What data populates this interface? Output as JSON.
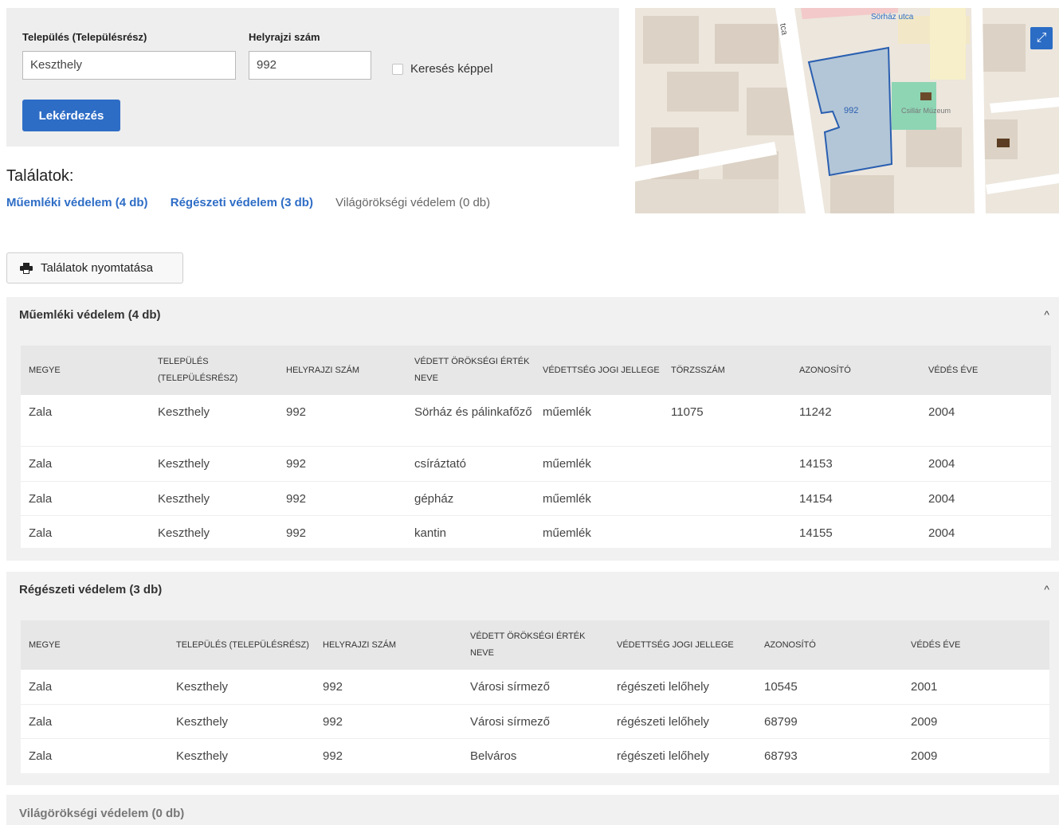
{
  "search": {
    "settlement_label": "Település (Településrész)",
    "settlement_value": "Keszthely",
    "parcel_label": "Helyrajzi szám",
    "parcel_value": "992",
    "image_search_label": "Keresés képpel",
    "query_button": "Lekérdezés"
  },
  "map": {
    "parcel_label": "992",
    "poi_labels": [
      "Sörház utca",
      "Csillár Múzeum"
    ],
    "street_label": "tca",
    "expand_icon": "expand-icon"
  },
  "results": {
    "title": "Találatok:",
    "links": [
      {
        "label": "Műemléki védelem (4 db)"
      },
      {
        "label": "Régészeti védelem (3 db)"
      },
      {
        "label": "Világörökségi védelem (0 db)"
      }
    ],
    "print_button": "Találatok nyomtatása"
  },
  "monuments": {
    "title": "Műemléki védelem (4 db)",
    "headers": [
      "Megye",
      "Település (településrész)",
      "Helyrajzi szám",
      "Védett örökségi érték neve",
      "Védettség jogi jellege",
      "Törzsszám",
      "Azonosító",
      "Védés éve"
    ],
    "rows": [
      [
        "Zala",
        "Keszthely",
        "992",
        "Sörház és pálinkafőző",
        "műemlék",
        "11075",
        "11242",
        "2004"
      ],
      [
        "Zala",
        "Keszthely",
        "992",
        "csíráztató",
        "műemlék",
        "",
        "14153",
        "2004"
      ],
      [
        "Zala",
        "Keszthely",
        "992",
        "gépház",
        "műemlék",
        "",
        "14154",
        "2004"
      ],
      [
        "Zala",
        "Keszthely",
        "992",
        "kantin",
        "műemlék",
        "",
        "14155",
        "2004"
      ]
    ]
  },
  "archaeology": {
    "title": "Régészeti védelem (3 db)",
    "headers": [
      "Megye",
      "Település (településrész)",
      "Helyrajzi szám",
      "Védett örökségi érték neve",
      "Védettség jogi jellege",
      "Azonosító",
      "Védés éve"
    ],
    "rows": [
      [
        "Zala",
        "Keszthely",
        "992",
        "Városi sírmező",
        "régészeti lelőhely",
        "10545",
        "2001"
      ],
      [
        "Zala",
        "Keszthely",
        "992",
        "Városi sírmező",
        "régészeti lelőhely",
        "68799",
        "2009"
      ],
      [
        "Zala",
        "Keszthely",
        "992",
        "Belváros",
        "régészeti lelőhely",
        "68793",
        "2009"
      ]
    ]
  },
  "world_heritage": {
    "title": "Világörökségi védelem (0 db)"
  },
  "colors": {
    "accent": "#2e6dc6",
    "panel": "#eeeeee",
    "section": "#f1f1f1",
    "parcel_fill": "#a9c0d6",
    "parcel_stroke": "#2a5fb0",
    "museum": "#8ed5b4"
  }
}
